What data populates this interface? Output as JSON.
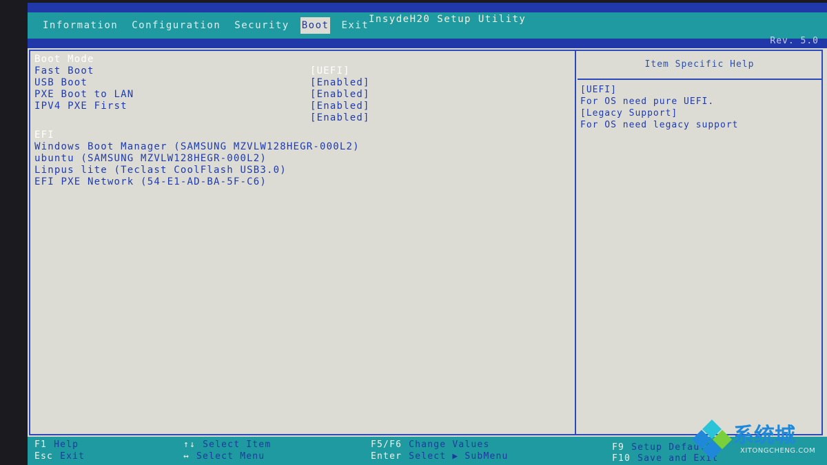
{
  "app": {
    "title": "InsydeH20 Setup Utility",
    "revision": "Rev. 5.0"
  },
  "tabs": [
    "Information",
    "Configuration",
    "Security",
    "Boot",
    "Exit"
  ],
  "boot": {
    "mode_label": "Boot Mode",
    "settings": [
      {
        "label": "Fast Boot",
        "value": "[UEFI]"
      },
      {
        "label": "USB Boot",
        "value": "[Enabled]"
      },
      {
        "label": "PXE Boot to LAN",
        "value": "[Enabled]"
      },
      {
        "label": "IPV4 PXE First",
        "value": "[Enabled]"
      },
      {
        "label": "",
        "value": "[Enabled]"
      }
    ],
    "efi_header": "EFI",
    "efi_entries": [
      "Windows Boot Manager (SAMSUNG MZVLW128HEGR-000L2)",
      "ubuntu (SAMSUNG MZVLW128HEGR-000L2)",
      "Linpus lite (Teclast CoolFlash USB3.0)",
      "EFI PXE Network (54-E1-AD-BA-5F-C6)"
    ]
  },
  "help": {
    "header": "Item Specific Help",
    "lines": [
      "[UEFI]",
      "For OS need pure UEFI.",
      "[Legacy Support]",
      "For OS need legacy support"
    ]
  },
  "status": {
    "f1_key": "F1",
    "f1_desc": "Help",
    "esc_key": "Esc",
    "esc_desc": "Exit",
    "arrows_ud_key": "↑↓",
    "arrows_ud_desc": "Select Item",
    "arrows_lr_key": "↔",
    "arrows_lr_desc": "Select Menu",
    "f5f6_key": "F5/F6",
    "f5f6_desc": "Change Values",
    "enter_key": "Enter",
    "enter_desc": "Select ▶ SubMenu",
    "f9_key": "F9",
    "f9_desc": "Setup Defaults",
    "f10_key": "F10",
    "f10_desc": "Save and Exit"
  },
  "watermark": {
    "text": "系统城",
    "sub": "XITONGCHENG.COM"
  },
  "colors": {
    "accent": "#2038a8",
    "teal": "#1f9aa0",
    "text_blue": "#1d3ab0"
  }
}
